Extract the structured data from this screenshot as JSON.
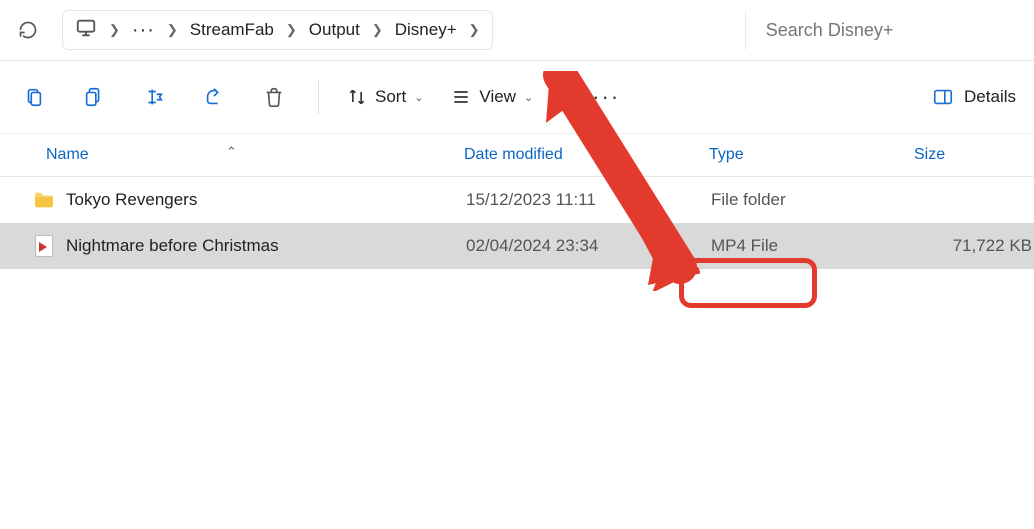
{
  "breadcrumbs": {
    "root_icon": "monitor-icon",
    "ellipsis": "···",
    "items": [
      "StreamFab",
      "Output",
      "Disney+"
    ]
  },
  "search": {
    "placeholder": "Search Disney+"
  },
  "toolbar": {
    "sort_label": "Sort",
    "view_label": "View",
    "details_label": "Details"
  },
  "columns": {
    "name": "Name",
    "date": "Date modified",
    "type": "Type",
    "size": "Size"
  },
  "rows": [
    {
      "icon": "folder",
      "name": "Tokyo Revengers",
      "date": "15/12/2023 11:11",
      "type": "File folder",
      "size": "",
      "selected": false
    },
    {
      "icon": "video-file",
      "name": "Nightmare before Christmas",
      "date": "02/04/2024 23:34",
      "type": "MP4 File",
      "size": "71,722 KB",
      "selected": true
    }
  ],
  "annotation": {
    "highlight_target": "row-1-type"
  }
}
